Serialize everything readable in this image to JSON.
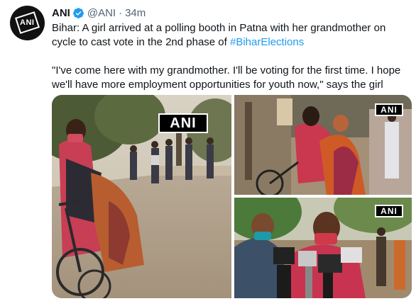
{
  "tweet": {
    "author_name": "ANI",
    "author_handle": "@ANI",
    "separator": "·",
    "timestamp": "34m",
    "avatar_text": "ANI",
    "text_line1": "Bihar: A girl arrived at a polling booth in Patna with her grandmother on cycle to cast vote in the 2nd phase of ",
    "hashtag": "#BiharElections",
    "text_line2": "\"I've come here with my grandmother. I'll be voting for the first time. I hope we'll have more employment opportunities for youth now,\" says the girl"
  },
  "media": {
    "photos": [
      {
        "watermark": "ANI",
        "icon": "photo-girl-on-cycle"
      },
      {
        "watermark": "ANI",
        "icon": "photo-grandmother-cycle-back"
      },
      {
        "watermark": "ANI",
        "icon": "photo-girl-interview-mics"
      }
    ]
  },
  "colors": {
    "link": "#1d9bf0",
    "secondary_text": "#536471",
    "primary_text": "#0f1419",
    "verified": "#1d9bf0"
  }
}
